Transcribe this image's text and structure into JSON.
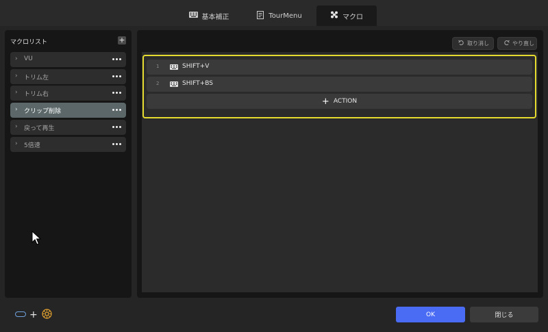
{
  "tabs": [
    {
      "label": "基本補正",
      "icon": "keyboard-icon",
      "active": false
    },
    {
      "label": "TourMenu",
      "icon": "document-icon",
      "active": false
    },
    {
      "label": "マクロ",
      "icon": "gear-cluster-icon",
      "active": true
    }
  ],
  "macro_list": {
    "title": "マクロリスト",
    "add_label": "+",
    "items": [
      {
        "label": "VU",
        "active": false
      },
      {
        "label": "トリム左",
        "active": false
      },
      {
        "label": "トリム右",
        "active": false
      },
      {
        "label": "クリップ削除",
        "active": true
      },
      {
        "label": "戻って再生",
        "active": false
      },
      {
        "label": "5倍速",
        "active": false
      }
    ]
  },
  "history": {
    "undo_label": "取り消し",
    "redo_label": "やり直し"
  },
  "actions": [
    {
      "num": "1",
      "key": "SHIFT+V"
    },
    {
      "num": "2",
      "key": "SHIFT+BS"
    }
  ],
  "add_action_label": "ACTION",
  "footer": {
    "ok_label": "OK",
    "close_label": "閉じる"
  },
  "colors": {
    "accent": "#4a6cf5",
    "highlight_border": "#e6dc2f",
    "active_item": "#5b6768"
  }
}
